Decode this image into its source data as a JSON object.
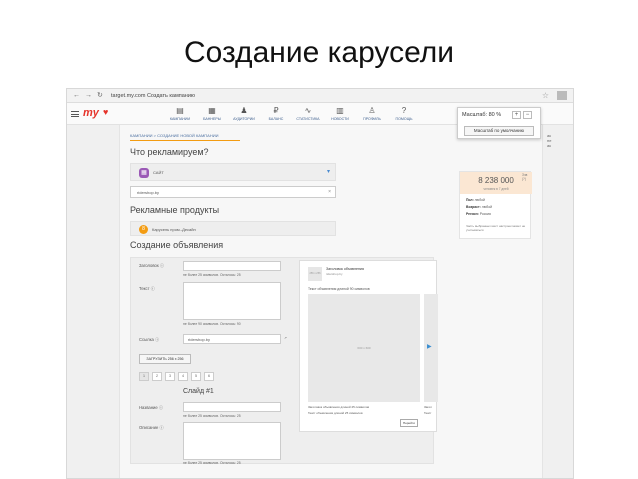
{
  "slide_title": "Создание карусели",
  "browser": {
    "back": "←",
    "forward": "→",
    "reload": "↻",
    "url": "target.my.com  Создать кампанию",
    "star": "☆"
  },
  "header": {
    "logo": "my",
    "logo_mark": "♥",
    "nav": [
      {
        "label": "КАМПАНИИ",
        "icon": "▤"
      },
      {
        "label": "БАННЕРЫ",
        "icon": "▦"
      },
      {
        "label": "АУДИТОРИИ",
        "icon": "♟"
      },
      {
        "label": "БАЛАНС",
        "icon": "₽"
      },
      {
        "label": "СТАТИСТИКА",
        "icon": "∿"
      },
      {
        "label": "НОВОСТИ",
        "icon": "▥"
      },
      {
        "label": "ПРОФИЛЬ",
        "icon": "♙"
      },
      {
        "label": "ПОМОЩЬ",
        "icon": "?"
      }
    ]
  },
  "zoom": {
    "label": "Масштаб: 80 %",
    "plus": "+",
    "minus": "−",
    "reset": "Масштаб по умолчанию"
  },
  "right_edge_text": "ак\nне\nак",
  "main": {
    "breadcrumb": "КАМПАНИИ > СОЗДАНИЕ НОВОЙ КАМПАНИИ",
    "what_heading": "Что рекламируем?",
    "site_label": "САЙТ",
    "site_icon": "▦",
    "url_value": "ridershop.by",
    "url_clear": "×",
    "products_heading": "Рекламные продукты",
    "product_label": "Карусель пром.-Десайн",
    "product_icon": "8",
    "ad_heading": "Создание объявления"
  },
  "form": {
    "title_label": "Заголовок",
    "title_hint": "не более 25 символов. Осталось: 25",
    "text_label": "Текст",
    "text_hint": "не более 90 символов. Осталось: 90",
    "link_label": "Ссылка",
    "link_value": "ridershop.by",
    "upload_label": "ЗАГРУЗИТЬ 256 х 256",
    "slide_tabs": [
      "1",
      "2",
      "3",
      "4",
      "5",
      "6"
    ],
    "slide_heading": "Слайд #1",
    "name_label": "Название",
    "name_hint": "не более 25 символов. Осталось: 25",
    "desc_label": "Описание",
    "desc_hint": "не более 25 символов. Осталось: 25"
  },
  "preview": {
    "thumb": "256 x 256",
    "title": "Заголовок объявления",
    "site": "ridershop.by",
    "text": "Текст объявления длиной 90 символов",
    "image": "600 x 600",
    "cap1": "Заголовок объявления длиной 25 символов",
    "cap2": "Текст объявления длиной 25 символов",
    "cap3": "Загол",
    "cap4": "Текст",
    "button": "Перейти",
    "arrow": "▶"
  },
  "stats": {
    "help": "Зчв (?)",
    "number": "8 238 000",
    "sub": "человек в 7 дней",
    "rows": [
      {
        "k": "Пол:",
        "v": "любой"
      },
      {
        "k": "Возраст:",
        "v": "любой"
      },
      {
        "k": "Регион:",
        "v": "Россия"
      }
    ],
    "note": "Часть выбранных мест настроек может не учитываться"
  }
}
